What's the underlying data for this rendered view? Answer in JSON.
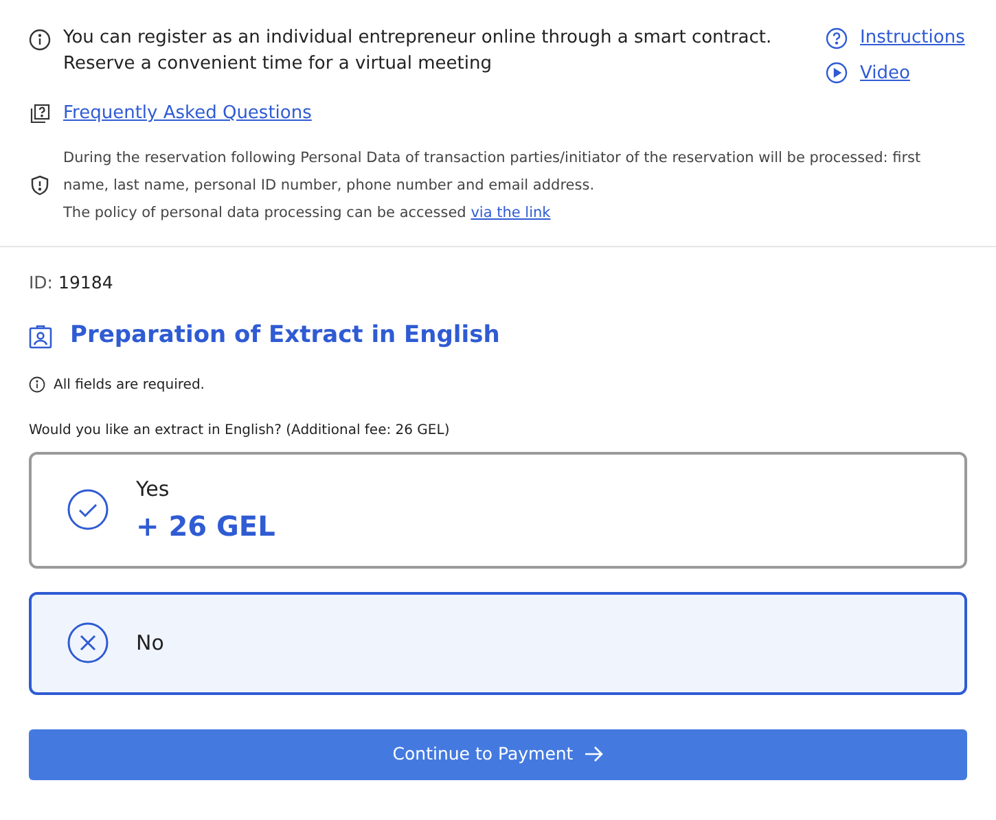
{
  "notice": {
    "text": "You can register as an individual entrepreneur online through a smart contract. Reserve a convenient time for a virtual meeting"
  },
  "links": [
    {
      "kind": "help",
      "label": "Instructions"
    },
    {
      "kind": "video",
      "label": "Video"
    }
  ],
  "faq": {
    "label": "Frequently Asked Questions"
  },
  "privacy": {
    "text": "During the reservation following Personal Data of transaction parties/initiator of the reservation will be processed: first name, last name, personal ID number, phone number and email address.",
    "policy": "The policy of personal data processing can be accessed",
    "link": "via the link"
  },
  "id": {
    "label": "ID:",
    "value": "19184"
  },
  "section": {
    "title": "Preparation of Extract in English"
  },
  "required_note": "All fields are required.",
  "question": "Would you like an extract in English? (Additional fee: 26 GEL)",
  "options": [
    {
      "kind": "yes",
      "label": "Yes",
      "price": "+ 26 GEL",
      "selected": false
    },
    {
      "kind": "no",
      "label": "No",
      "selected": true
    }
  ],
  "continue_button": "Continue to Payment"
}
